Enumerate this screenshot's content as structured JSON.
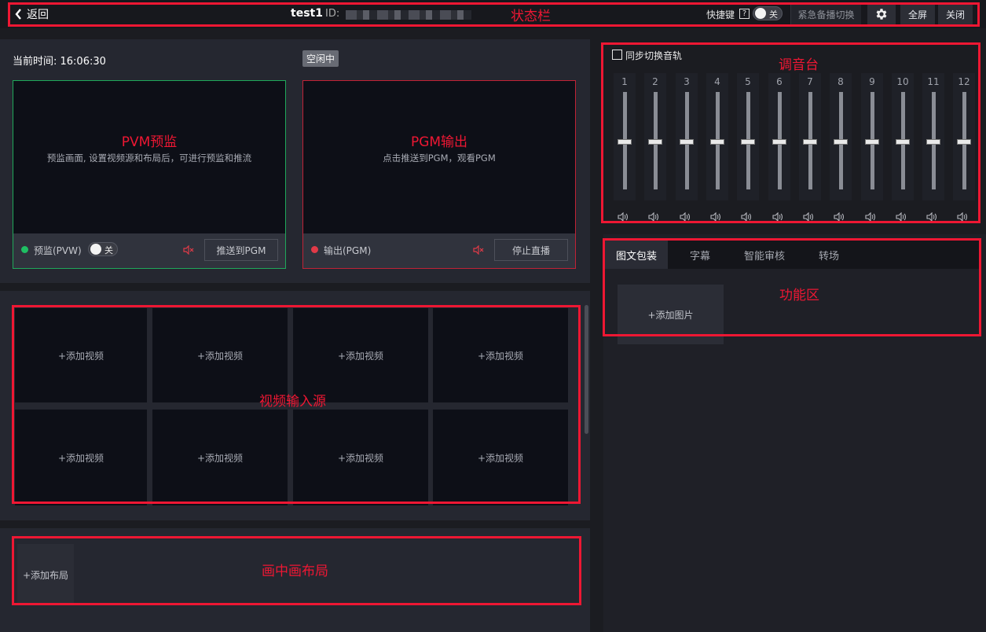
{
  "topbar": {
    "back_label": "返回",
    "title": "test1",
    "id_label": "ID:",
    "shortcut_label": "快捷键",
    "help_label": "?",
    "shortcut_toggle": "关",
    "emergency_label": "紧急备播切换",
    "fullscreen_label": "全屏",
    "close_label": "关闭"
  },
  "monitor": {
    "current_time_label": "当前时间: 16:06:30",
    "status_badge": "空闲中",
    "pvw": {
      "title": "PVM预监",
      "subtitle": "预监画面, 设置视频源和布局后，可进行预监和推流",
      "label": "预监(PVW)",
      "toggle": "关",
      "action": "推送到PGM"
    },
    "pgm": {
      "title": "PGM输出",
      "subtitle": "点击推送到PGM，观看PGM",
      "label": "输出(PGM)",
      "action": "停止直播"
    }
  },
  "inputs": {
    "tiles": [
      "+添加视频",
      "+添加视频",
      "+添加视频",
      "+添加视频",
      "+添加视频",
      "+添加视频",
      "+添加视频",
      "+添加视频"
    ]
  },
  "layout": {
    "add_label": "+添加布局"
  },
  "mixer": {
    "sync_label": "同步切换音轨",
    "channels": [
      "1",
      "2",
      "3",
      "4",
      "5",
      "6",
      "7",
      "8",
      "9",
      "10",
      "11",
      "12"
    ],
    "levels": [
      0.49,
      0.49,
      0.49,
      0.49,
      0.49,
      0.49,
      0.49,
      0.49,
      0.49,
      0.49,
      0.49,
      0.49
    ]
  },
  "features": {
    "tabs": [
      "图文包装",
      "字幕",
      "智能审核",
      "转场"
    ],
    "add_image_label": "+添加图片"
  },
  "annotations": {
    "status_bar": "状态栏",
    "mixer": "调音台",
    "features": "功能区",
    "video_inputs": "视频输入源",
    "pip_layout": "画中画布局"
  },
  "colors": {
    "annotation_red": "#ee1733",
    "pvw_border": "#1fa85a",
    "pgm_border": "#c02236",
    "live_green": "#1fbf63",
    "live_red": "#e23a48"
  }
}
